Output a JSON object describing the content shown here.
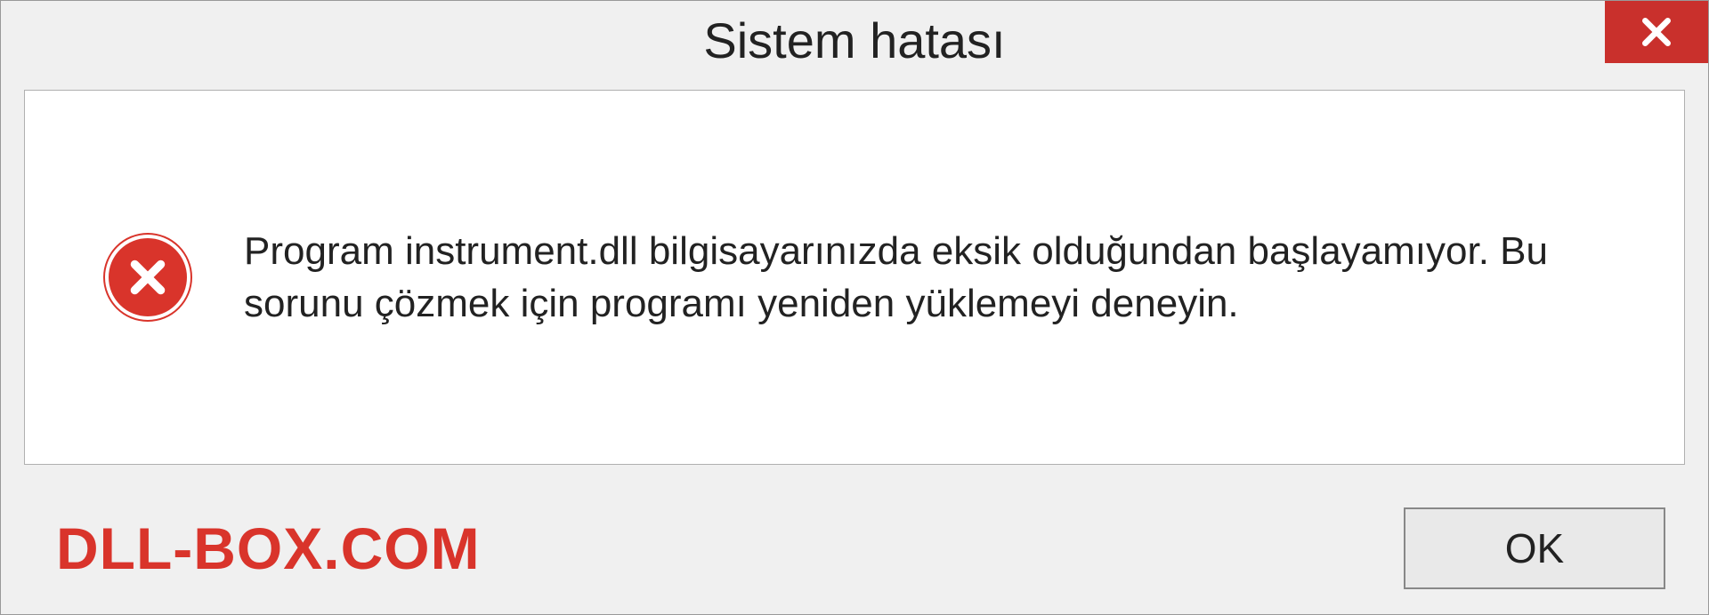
{
  "titlebar": {
    "title": "Sistem hatası"
  },
  "content": {
    "error_icon": "error-circle-x-icon",
    "message": "Program instrument.dll bilgisayarınızda eksik olduğundan başlayamıyor. Bu sorunu çözmek için programı yeniden yüklemeyi deneyin."
  },
  "footer": {
    "watermark": "DLL-BOX.COM",
    "ok_label": "OK"
  },
  "colors": {
    "accent_red": "#d9342b",
    "close_red": "#c9302c",
    "bg": "#f0f0f0",
    "white": "#ffffff"
  }
}
